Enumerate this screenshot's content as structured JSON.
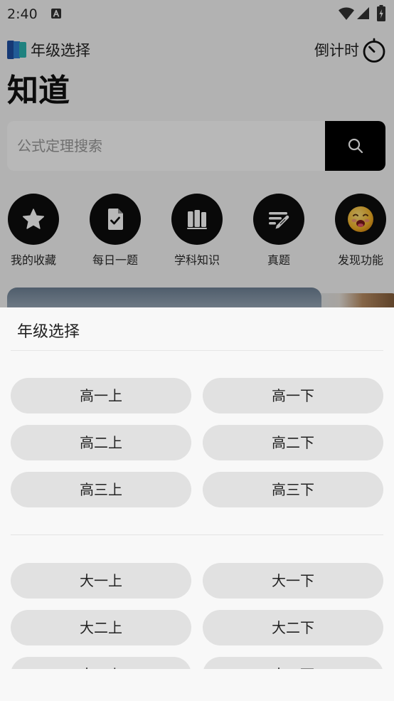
{
  "status_bar": {
    "time": "2:40"
  },
  "header": {
    "grade_label": "年级选择",
    "countdown_label": "倒计时"
  },
  "app_title": "知道",
  "search": {
    "placeholder": "公式定理搜索"
  },
  "shortcuts": [
    {
      "label": "我的收藏",
      "icon": "star-icon"
    },
    {
      "label": "每日一题",
      "icon": "document-check-icon"
    },
    {
      "label": "学科知识",
      "icon": "books-icon"
    },
    {
      "label": "真题",
      "icon": "pen-lines-icon"
    },
    {
      "label": "发现功能",
      "icon": "emoji-face-icon"
    }
  ],
  "sheet": {
    "title": "年级选择",
    "groups": [
      {
        "options": [
          "高一上",
          "高一下",
          "高二上",
          "高二下",
          "高三上",
          "高三下"
        ]
      },
      {
        "options": [
          "大一上",
          "大一下",
          "大二上",
          "大二下",
          "大三上",
          "大三下"
        ]
      }
    ]
  },
  "colors": {
    "search_button": "#000000",
    "shortcut_circle": "#0d0d0d",
    "sheet_background": "#f8f8f8",
    "option_background": "#e1e1e1"
  }
}
